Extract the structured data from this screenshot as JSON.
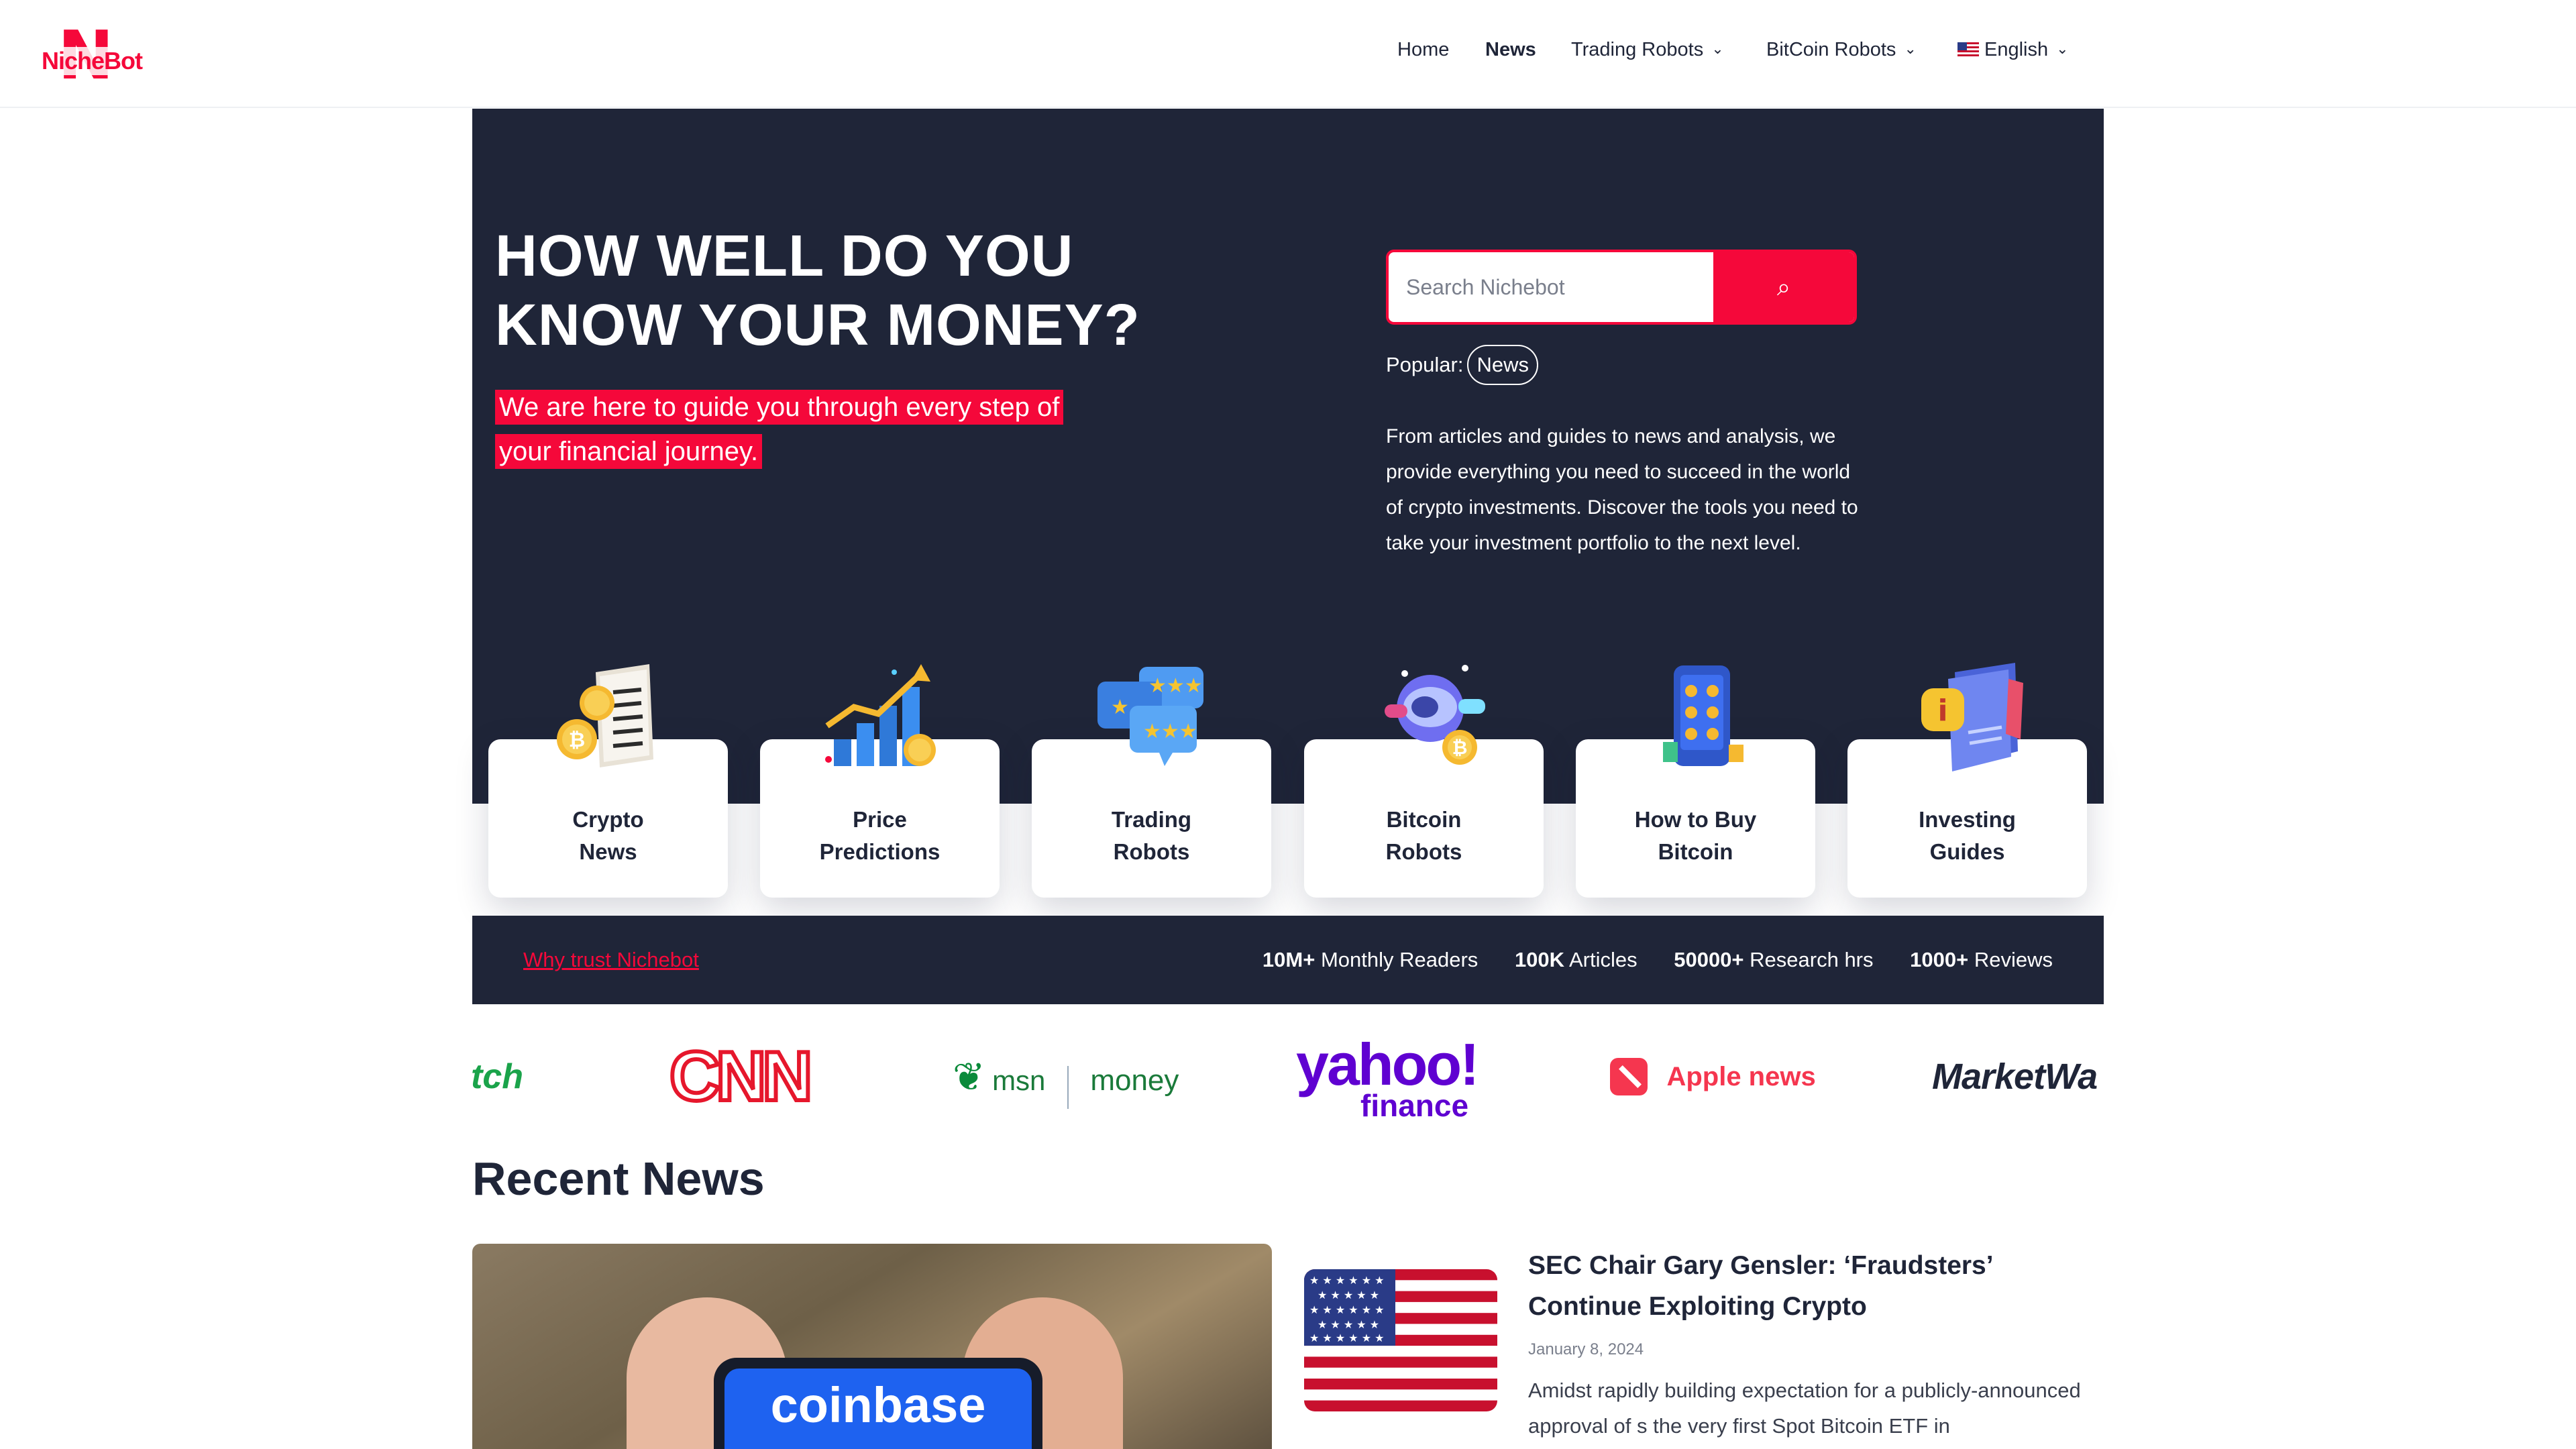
{
  "brand": {
    "logo_letter": "N",
    "logo_text": "NicheBot",
    "accent": "#f5083a",
    "dark": "#1f2538"
  },
  "nav": {
    "items": [
      {
        "label": "Home"
      },
      {
        "label": "News"
      },
      {
        "label": "Trading Robots"
      },
      {
        "label": "BitCoin Robots"
      }
    ],
    "language": "English"
  },
  "hero": {
    "title": "HOW WELL DO YOU KNOW YOUR MONEY?",
    "tagline": "We are here to guide you through every step of your financial journey.",
    "search_placeholder": "Search Nichebot",
    "popular_label": "Popular:",
    "popular_tag": "News",
    "description": "From articles and guides to news and analysis, we provide everything you need to succeed in the world of crypto investments. Discover the tools you need to take your investment portfolio to the next level."
  },
  "categories": [
    {
      "line1": "Crypto",
      "line2": "News",
      "icon": "newspaper-bitcoin-icon"
    },
    {
      "line1": "Price",
      "line2": "Predictions",
      "icon": "chart-growth-icon"
    },
    {
      "line1": "Trading",
      "line2": "Robots",
      "icon": "rating-stars-icon"
    },
    {
      "line1": "Bitcoin",
      "line2": "Robots",
      "icon": "robot-bitcoin-icon"
    },
    {
      "line1": "How to Buy",
      "line2": "Bitcoin",
      "icon": "phone-calculator-icon"
    },
    {
      "line1": "Investing",
      "line2": "Guides",
      "icon": "guide-book-icon"
    }
  ],
  "trust": {
    "link": "Why trust Nichebot",
    "stats": [
      {
        "value": "10M+",
        "label": "Monthly Readers"
      },
      {
        "value": "100K",
        "label": "Articles"
      },
      {
        "value": "50000+",
        "label": "Research hrs"
      },
      {
        "value": "1000+",
        "label": "Reviews"
      }
    ]
  },
  "press": {
    "partial_left": "tch",
    "cnn": "CNN",
    "msn": "msn",
    "money": "money",
    "yahoo": "yahoo!",
    "yahoo_sub": "finance",
    "apple": "Apple news",
    "marketwatch": "MarketWa"
  },
  "recent": {
    "heading": "Recent News",
    "featured_image_text": "coinbase",
    "article": {
      "title": "SEC Chair Gary Gensler: ‘Fraudsters’ Continue Exploiting Crypto",
      "date": "January 8, 2024",
      "excerpt": "Amidst rapidly building expectation for a publicly-announced approval of s the very first Spot Bitcoin ETF in"
    }
  }
}
